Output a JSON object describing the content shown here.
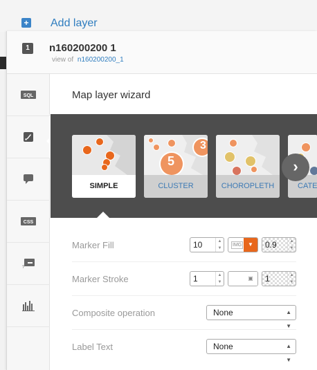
{
  "top": {
    "add_layer_label": "Add layer",
    "add_icon_glyph": "+"
  },
  "layer": {
    "number": "1",
    "name": "n160200200 1",
    "view_of_label": "view of",
    "view_of_source": "n160200200_1"
  },
  "sidebar": {
    "items": [
      {
        "name": "sql",
        "icon": "sql-icon"
      },
      {
        "name": "wizard",
        "icon": "paintbrush-icon",
        "active": true
      },
      {
        "name": "infowindow",
        "icon": "speech-bubble-icon"
      },
      {
        "name": "css",
        "icon": "css-icon"
      },
      {
        "name": "legend",
        "icon": "legend-icon"
      },
      {
        "name": "filters",
        "icon": "bar-chart-icon"
      }
    ]
  },
  "wizard": {
    "title": "Map layer wizard",
    "types": [
      {
        "label": "SIMPLE",
        "selected": true
      },
      {
        "label": "CLUSTER",
        "selected": false,
        "thumb_number": "5",
        "thumb_number_2": "3"
      },
      {
        "label": "CHOROPLETH",
        "selected": false
      },
      {
        "label": "CATE",
        "selected": false
      }
    ],
    "next_glyph": "›"
  },
  "form": {
    "marker_fill": {
      "label": "Marker Fill",
      "width": "10",
      "img_label": "IMG",
      "color": "#e8671c",
      "opacity": "0.9"
    },
    "marker_stroke": {
      "label": "Marker Stroke",
      "width": "1",
      "opacity": "1"
    },
    "composite_operation": {
      "label": "Composite operation",
      "value": "None"
    },
    "label_text": {
      "label": "Label Text",
      "value": "None"
    }
  },
  "colors": {
    "accent_orange": "#e8671c",
    "link_blue": "#2f7dbf",
    "carousel_bg": "#4d4d4d"
  }
}
